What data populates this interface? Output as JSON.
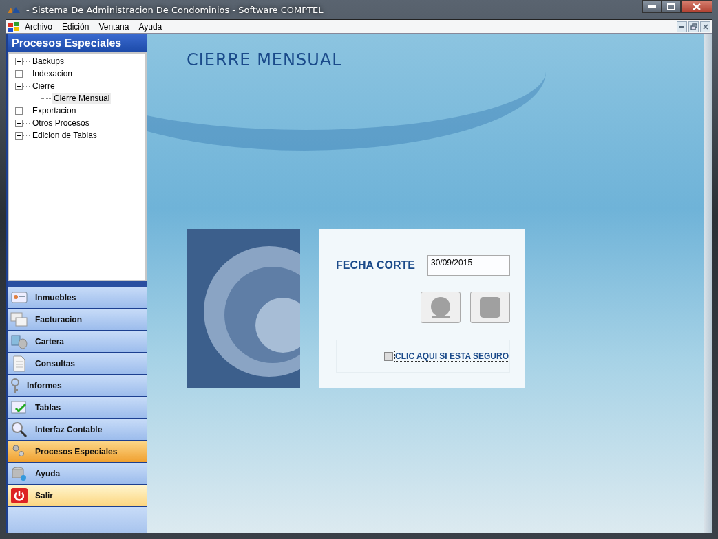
{
  "window": {
    "title": "- Sistema De Administracion De Condominios - Software COMPTEL"
  },
  "menu": [
    "Archivo",
    "Edición",
    "Ventana",
    "Ayuda"
  ],
  "sidebar": {
    "title": "Procesos Especiales",
    "tree": [
      {
        "label": "Backups",
        "expanded": false,
        "selected": false
      },
      {
        "label": "Indexacion",
        "expanded": false,
        "selected": false
      },
      {
        "label": "Cierre",
        "expanded": true,
        "selected": false,
        "children": [
          {
            "label": "Cierre Mensual",
            "selected": true
          }
        ]
      },
      {
        "label": "Exportacion",
        "expanded": false,
        "selected": false
      },
      {
        "label": "Otros Procesos",
        "expanded": false,
        "selected": false
      },
      {
        "label": "Edicion de Tablas",
        "expanded": false,
        "selected": false
      }
    ],
    "nav": [
      {
        "label": "Inmuebles",
        "selected": false,
        "hovered": false
      },
      {
        "label": "Facturacion",
        "selected": false,
        "hovered": false
      },
      {
        "label": "Cartera",
        "selected": false,
        "hovered": false
      },
      {
        "label": "Consultas",
        "selected": false,
        "hovered": false
      },
      {
        "label": "Informes",
        "selected": false,
        "hovered": false
      },
      {
        "label": "Tablas",
        "selected": false,
        "hovered": false
      },
      {
        "label": "Interfaz Contable",
        "selected": false,
        "hovered": false
      },
      {
        "label": "Procesos Especiales",
        "selected": true,
        "hovered": false
      },
      {
        "label": "Ayuda",
        "selected": false,
        "hovered": false
      },
      {
        "label": "Salir",
        "selected": false,
        "hovered": true
      }
    ]
  },
  "content": {
    "heading": "CIERRE MENSUAL",
    "form": {
      "label": "FECHA CORTE",
      "date": "30/09/2015",
      "confirm": {
        "label": "CLIC AQUI SI ESTA SEGURO",
        "checked": false
      }
    }
  }
}
